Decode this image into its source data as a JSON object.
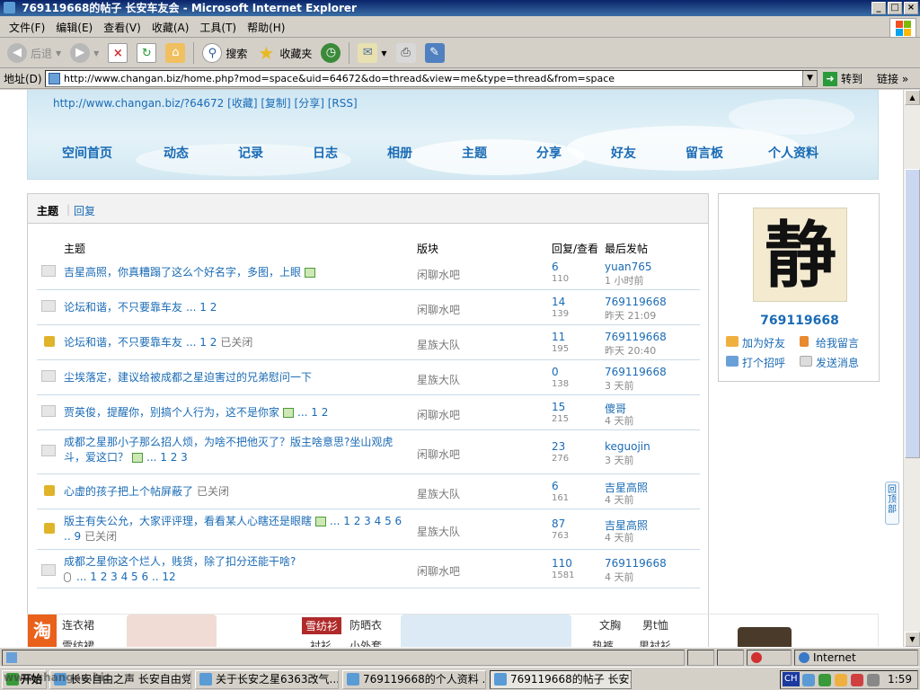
{
  "window": {
    "title": "769119668的帖子 长安车友会 - Microsoft Internet Explorer",
    "btn_min": "_",
    "btn_max": "□",
    "btn_close": "×"
  },
  "menu": [
    "文件(F)",
    "编辑(E)",
    "查看(V)",
    "收藏(A)",
    "工具(T)",
    "帮助(H)"
  ],
  "toolbar": {
    "back": "后退",
    "search": "搜索",
    "favorites": "收藏夹"
  },
  "address": {
    "label": "地址(D)",
    "url": "http://www.changan.biz/home.php?mod=space&uid=64672&do=thread&view=me&type=thread&from=space",
    "go": "转到",
    "links": "链接 »"
  },
  "space": {
    "url_text": "http://www.changan.biz/?64672",
    "actions": [
      "[收藏]",
      "[复制]",
      "[分享]",
      "[RSS]"
    ],
    "nav": [
      "空间首页",
      "动态",
      "记录",
      "日志",
      "相册",
      "主题",
      "分享",
      "好友",
      "留言板",
      "个人资料"
    ]
  },
  "tabs": {
    "active": "主题",
    "other": "回复"
  },
  "headers": {
    "subject": "主题",
    "forum": "版块",
    "reply_view": "回复/查看",
    "last_post": "最后发帖"
  },
  "threads": [
    {
      "title": "吉星高照，你真糟蹋了这么个好名字，多图，上眼",
      "img": true,
      "pages": "",
      "closed": "",
      "forum": "闲聊水吧",
      "replies": "6",
      "views": "110",
      "last_user": "yuan765",
      "last_time": "1 小时前",
      "locked": false
    },
    {
      "title": "论坛和谐，不只要靠车友",
      "img": false,
      "pages": "... 1 2",
      "closed": "",
      "forum": "闲聊水吧",
      "replies": "14",
      "views": "139",
      "last_user": "769119668",
      "last_time": "昨天 21:09",
      "locked": false
    },
    {
      "title": "论坛和谐，不只要靠车友",
      "img": false,
      "pages": "... 1 2",
      "closed": "已关闭",
      "forum": "星族大队",
      "replies": "11",
      "views": "195",
      "last_user": "769119668",
      "last_time": "昨天 20:40",
      "locked": true
    },
    {
      "title": "尘埃落定，建议给被成都之星迫害过的兄弟慰问一下",
      "img": false,
      "pages": "",
      "closed": "",
      "forum": "星族大队",
      "replies": "0",
      "views": "138",
      "last_user": "769119668",
      "last_time": "3 天前",
      "locked": false
    },
    {
      "title": "贾英俊，提醒你，别搞个人行为，这不是你家",
      "img": true,
      "pages": "... 1 2",
      "closed": "",
      "forum": "闲聊水吧",
      "replies": "15",
      "views": "215",
      "last_user": "傻哥",
      "last_time": "4 天前",
      "locked": false
    },
    {
      "title": "成都之星那小子那么招人烦，为啥不把他灭了？版主啥意思?坐山观虎斗，爱这口？",
      "img": true,
      "pages": "... 1 2 3",
      "closed": "",
      "forum": "闲聊水吧",
      "replies": "23",
      "views": "276",
      "last_user": "keguojin",
      "last_time": "3 天前",
      "locked": false
    },
    {
      "title": "心虚的孩子把上个帖屏蔽了",
      "img": false,
      "pages": "",
      "closed": "已关闭",
      "forum": "星族大队",
      "replies": "6",
      "views": "161",
      "last_user": "吉星高照",
      "last_time": "4 天前",
      "locked": true
    },
    {
      "title": "版主有失公允，大家评评理，看看某人心瞎还是眼瞎",
      "img": true,
      "pages": "... 1 2 3 4 5 6 .. 9",
      "closed": "已关闭",
      "forum": "星族大队",
      "replies": "87",
      "views": "763",
      "last_user": "吉星高照",
      "last_time": "4 天前",
      "locked": true
    },
    {
      "title": "成都之星你这个烂人，贱货，除了扣分还能干啥?",
      "img": false,
      "clip": true,
      "pages": "... 1 2 3 4 5 6 .. 12",
      "closed": "",
      "forum": "闲聊水吧",
      "replies": "110",
      "views": "1581",
      "last_user": "769119668",
      "last_time": "4 天前",
      "locked": false
    }
  ],
  "profile": {
    "avatar_char": "静",
    "username": "769119668",
    "add_friend": "加为好友",
    "leave_msg": "给我留言",
    "greet": "打个招呼",
    "send_msg": "发送消息"
  },
  "totop": "回顶部",
  "ads": {
    "logo": "淘",
    "items": [
      "连衣裙",
      "雪纺衫",
      "防晒衣",
      "文胸",
      "男t恤",
      "雪纺裙",
      "衬衫",
      "小外套",
      "热裤",
      "男衬衫"
    ]
  },
  "status": {
    "zone": "Internet"
  },
  "taskbar": {
    "start": "开始",
    "tasks": [
      "长安自由之声",
      "长安自由党：..",
      "关于长安之星6363改气...",
      "769119668的个人资料 ...",
      "769119668的帖子 长安..."
    ],
    "watermark": "www.changan.biz",
    "input": "CH",
    "clock": "1:59"
  }
}
